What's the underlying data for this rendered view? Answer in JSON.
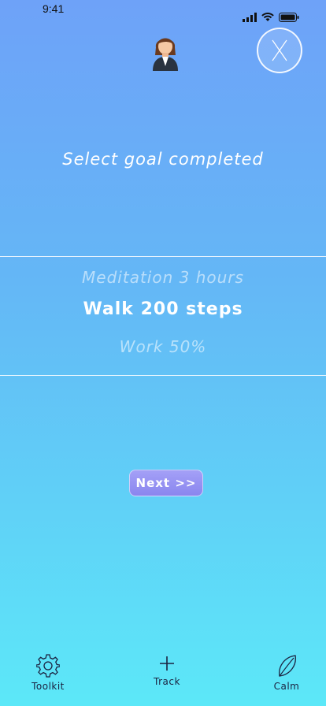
{
  "status_bar": {
    "time": "9:41"
  },
  "header": {
    "avatar_icon": "businesswoman-avatar-icon",
    "close_icon": "close-icon"
  },
  "main": {
    "heading": "Select goal completed",
    "picker": {
      "items": [
        "Meditation 3 hours",
        "Walk 200 steps",
        "Work 50%"
      ],
      "selected": "Walk 200 steps"
    },
    "next_label": "Next >>"
  },
  "tab_bar": {
    "items": [
      {
        "label": "Toolkit",
        "icon": "gear-icon"
      },
      {
        "label": "Track",
        "icon": "plus-icon"
      },
      {
        "label": "Calm",
        "icon": "leaf-icon"
      }
    ]
  },
  "colors": {
    "gradient_top": "#6ea2f8",
    "gradient_bottom": "#5ce8f8",
    "button": "#9894f2"
  }
}
